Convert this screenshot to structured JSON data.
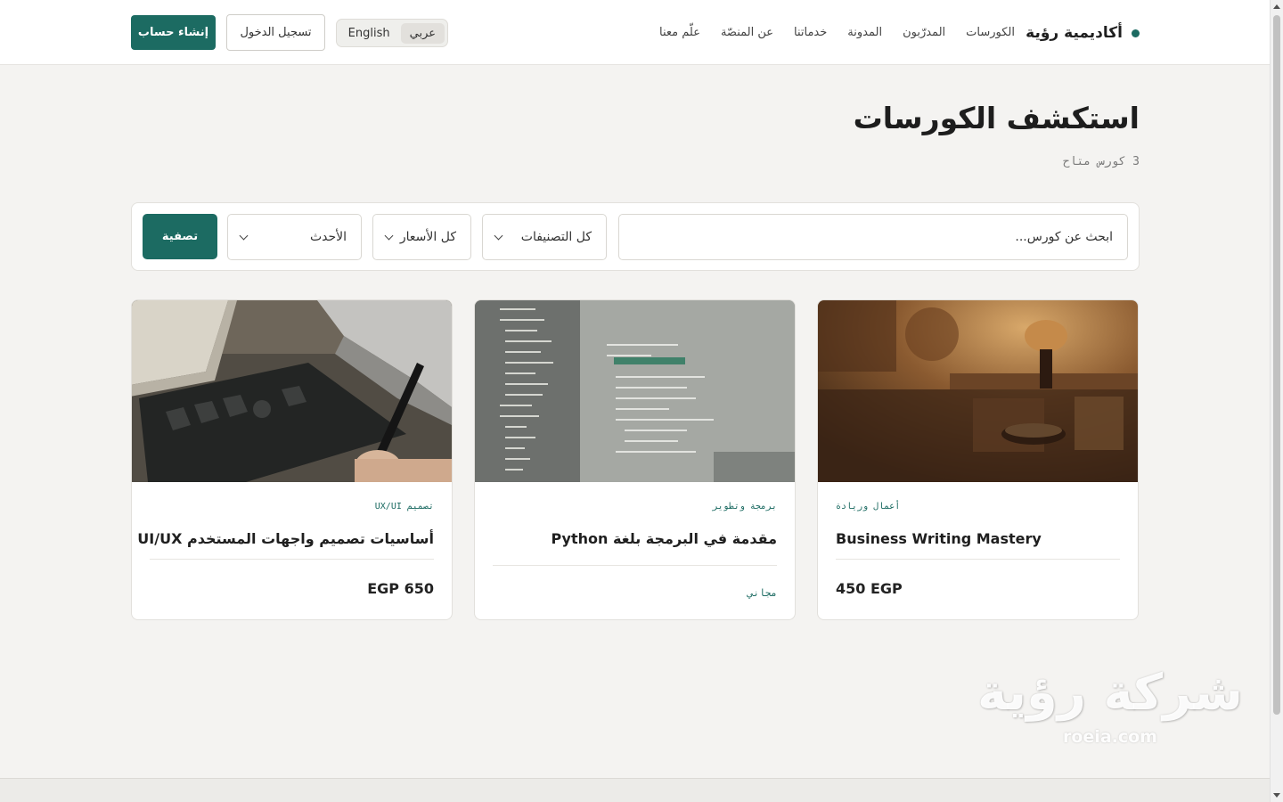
{
  "header": {
    "brand": "أكاديمية رؤية",
    "nav": [
      "الكورسات",
      "المدرّبون",
      "المدونة",
      "خدماتنا",
      "عن المنصّة",
      "علّم معنا"
    ],
    "lang_ar": "عربي",
    "lang_en": "English",
    "login_label": "تسجيل الدخول",
    "signup_label": "إنشاء حساب"
  },
  "main": {
    "title": "استكشف الكورسات",
    "count": "3 كورس متاح"
  },
  "filters": {
    "search_placeholder": "ابحث عن كورس...",
    "category": "كل التصنيفات",
    "price": "كل الأسعار",
    "sort": "الأحدث",
    "apply_label": "تصفية"
  },
  "courses": [
    {
      "category": "أعمال وريادة",
      "title": "Business Writing Mastery",
      "price": "450  EGP"
    },
    {
      "category": "برمجة وتطوير",
      "title": "مقدمة في البرمجة بلغة Python",
      "price": "مجاني"
    },
    {
      "category": "تصميم UX/UI",
      "title": "أساسيات تصميم واجهات المستخدم UI/UX",
      "price": "EGP  650"
    }
  ],
  "watermark": {
    "main": "شركة رؤية",
    "sub": "roeia.com"
  },
  "colors": {
    "accent": "#1c6b62",
    "background": "#f4f3f1"
  }
}
